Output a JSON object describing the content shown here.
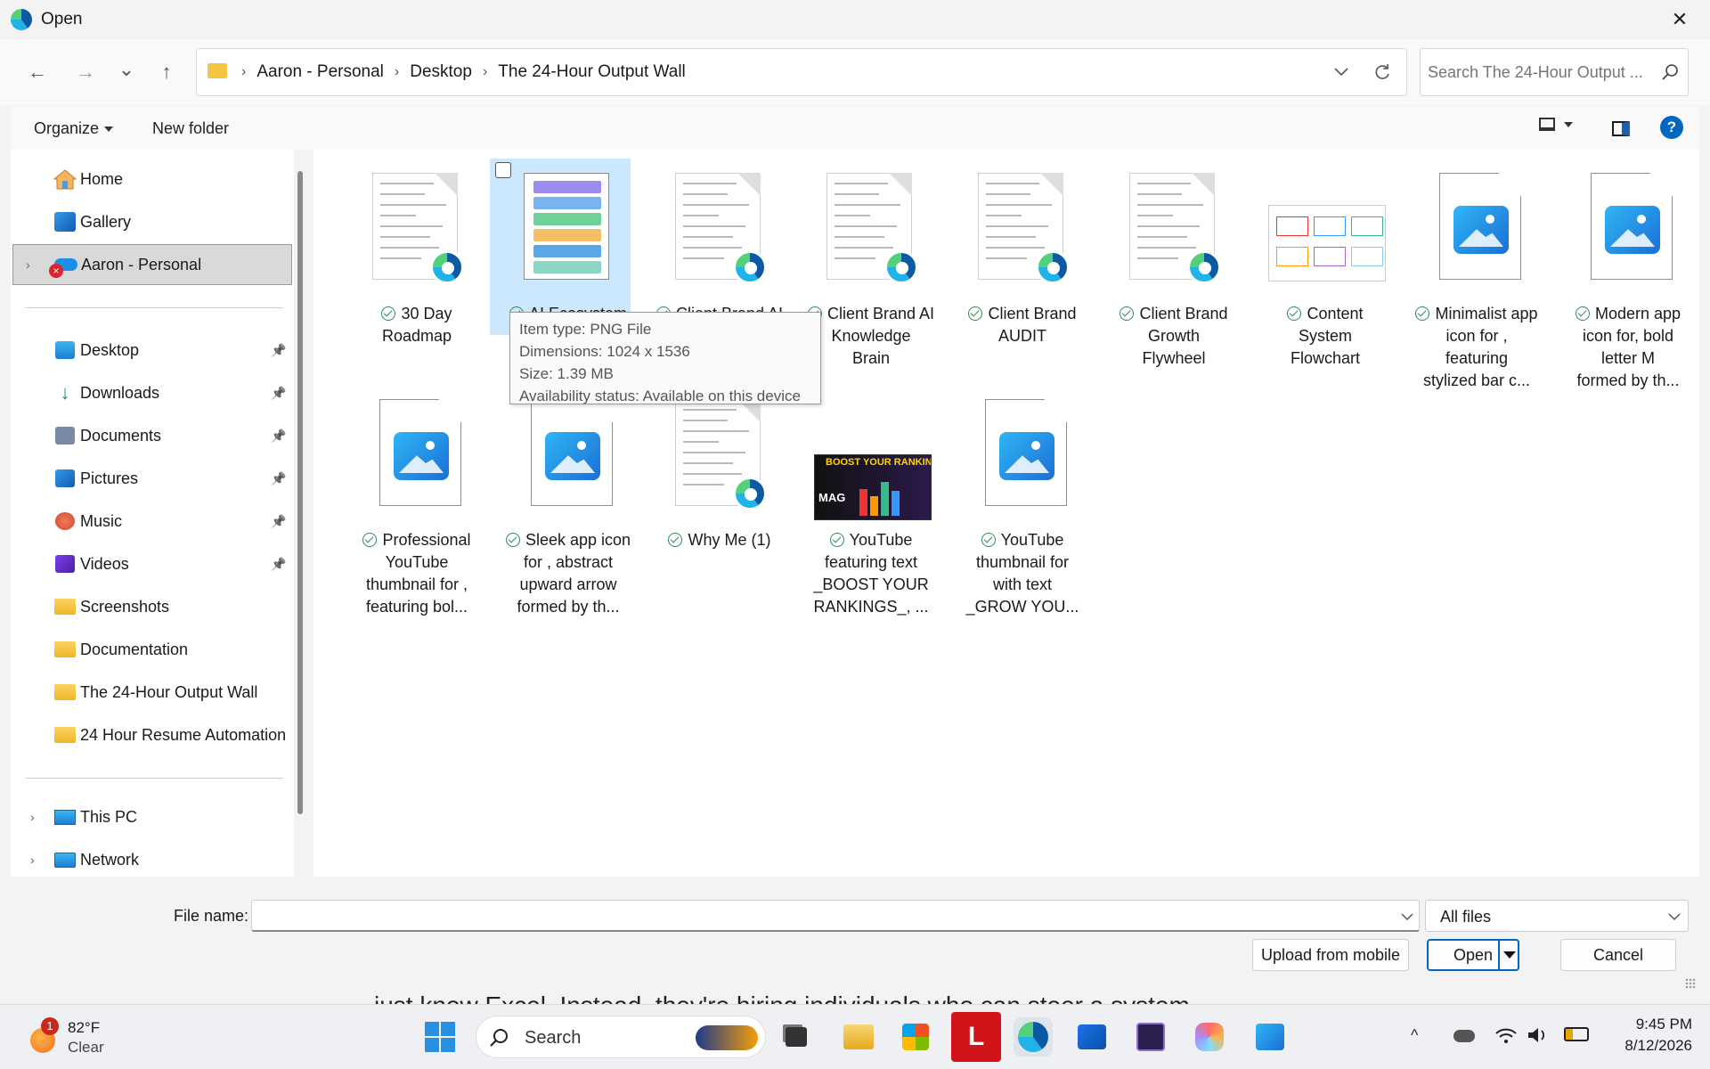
{
  "window": {
    "title": "Open",
    "close_glyph": "✕"
  },
  "nav_buttons": {
    "back": "←",
    "forward": "→",
    "recent": "⌄",
    "up": "↑"
  },
  "breadcrumb": [
    "Aaron - Personal",
    "Desktop",
    "The 24-Hour Output Wall"
  ],
  "breadcrumb_sep": "›",
  "search": {
    "placeholder": "Search The 24-Hour Output ..."
  },
  "toolbar": {
    "organize": "Organize",
    "new_folder": "New folder"
  },
  "sidebar": {
    "home": "Home",
    "gallery": "Gallery",
    "onedrive": "Aaron - Personal",
    "quick": [
      {
        "label": "Desktop",
        "pinned": true
      },
      {
        "label": "Downloads",
        "pinned": true
      },
      {
        "label": "Documents",
        "pinned": true
      },
      {
        "label": "Pictures",
        "pinned": true
      },
      {
        "label": "Music",
        "pinned": true
      },
      {
        "label": "Videos",
        "pinned": true
      },
      {
        "label": "Screenshots",
        "pinned": false
      },
      {
        "label": "Documentation",
        "pinned": false
      },
      {
        "label": "The 24-Hour Output Wall",
        "pinned": false
      },
      {
        "label": "24 Hour Resume Automation",
        "pinned": false
      }
    ],
    "this_pc": "This PC",
    "network": "Network"
  },
  "files": [
    {
      "line1": "30 Day",
      "line2": "Roadmap",
      "line3": "",
      "line4": "",
      "kind": "pdf"
    },
    {
      "line1": "AI Ecosystem",
      "line2": "",
      "line3": "",
      "line4": "",
      "kind": "png-selected"
    },
    {
      "line1": "Client Brand AI",
      "line2": "",
      "line3": "",
      "line4": "",
      "kind": "pdf"
    },
    {
      "line1": "Client Brand AI",
      "line2": "Knowledge",
      "line3": "Brain",
      "line4": "",
      "kind": "pdf"
    },
    {
      "line1": "Client Brand",
      "line2": "AUDIT",
      "line3": "",
      "line4": "",
      "kind": "pdf"
    },
    {
      "line1": "Client Brand",
      "line2": "Growth",
      "line3": "Flywheel",
      "line4": "",
      "kind": "pdf"
    },
    {
      "line1": "Content",
      "line2": "System",
      "line3": "Flowchart",
      "line4": "",
      "kind": "png"
    },
    {
      "line1": "Minimalist app",
      "line2": "icon for ,",
      "line3": "featuring",
      "line4": "stylized bar c...",
      "kind": "image"
    },
    {
      "line1": "Modern app",
      "line2": "icon for, bold",
      "line3": "letter M",
      "line4": "formed by th...",
      "kind": "image"
    },
    {
      "line1": "Professional",
      "line2": "YouTube",
      "line3": "thumbnail for ,",
      "line4": "featuring bol...",
      "kind": "image"
    },
    {
      "line1": "Sleek app icon",
      "line2": "for , abstract",
      "line3": "upward arrow",
      "line4": "formed by th...",
      "kind": "image"
    },
    {
      "line1": "Why Me (1)",
      "line2": "",
      "line3": "",
      "line4": "",
      "kind": "pdf"
    },
    {
      "line1": "YouTube",
      "line2": "featuring text",
      "line3": "_BOOST YOUR",
      "line4": "RANKINGS_, ...",
      "kind": "youtube"
    },
    {
      "line1": "YouTube",
      "line2": "thumbnail for",
      "line3": "with text",
      "line4": "_GROW YOU...",
      "kind": "image"
    }
  ],
  "thumb_text": {
    "boost": "BOOST YOUR RANKINGS",
    "mag": "MAG"
  },
  "tooltip": {
    "type": "Item type: PNG File",
    "dims": "Dimensions: 1024 x 1536",
    "size": "Size: 1.39 MB",
    "avail": "Availability status: Available on this device"
  },
  "footer": {
    "filename_label": "File name:",
    "filename_value": "",
    "filter": "All files",
    "upload": "Upload from mobile",
    "open": "Open",
    "cancel": "Cancel"
  },
  "background_text": "just know Excel. Instead, they're hiring individuals who can steer a system",
  "taskbar": {
    "weather_temp": "82°F",
    "weather_desc": "Clear",
    "weather_badge": "1",
    "search_label": "Search",
    "time": "9:45 PM",
    "date": "8/12/2026"
  },
  "colors": {
    "accent": "#0067c0",
    "selected": "#cce8ff",
    "check": "#2e8b57"
  }
}
